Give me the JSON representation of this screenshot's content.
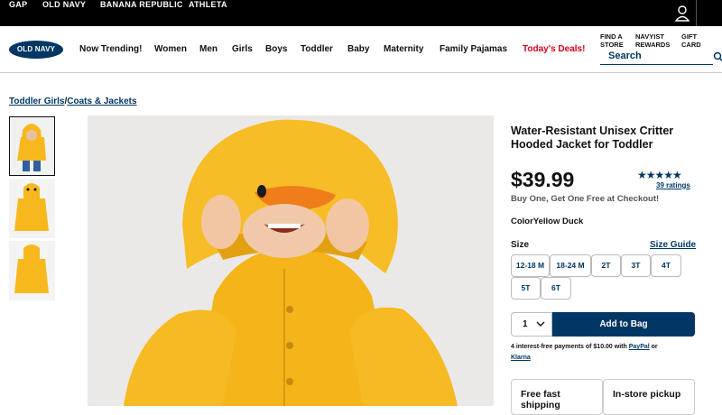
{
  "brandbar": {
    "brands": [
      "GAP",
      "OLD NAVY",
      "BANANA REPUBLIC",
      "ATHLETA"
    ]
  },
  "nav": {
    "logo": "OLD NAVY",
    "items": [
      "Now Trending!",
      "Women",
      "Men",
      "Girls",
      "Boys",
      "Toddler",
      "Baby",
      "Maternity",
      "Family Pajamas",
      "Today's Deals!"
    ],
    "utility": [
      {
        "line1": "FIND A",
        "line2": "STORE"
      },
      {
        "line1": "NAVYIST",
        "line2": "REWARDS"
      },
      {
        "line1": "GIFT",
        "line2": "CARD"
      }
    ],
    "search_label": "Search"
  },
  "breadcrumb": {
    "first": "Toddler Girls",
    "sep": "/",
    "second": "Coats & Jackets"
  },
  "product": {
    "title": "Water-Resistant Unisex Critter Hooded Jacket for Toddler",
    "price": "$39.99",
    "stars": "★★★★★",
    "ratings": "39 ratings",
    "promo": "Buy One, Get One Free at Checkout!",
    "color_label": "Color",
    "color_value": "Yellow Duck",
    "size_label": "Size",
    "size_guide": "Size Guide",
    "sizes": [
      "12-18 M",
      "18-24 M",
      "2T",
      "3T",
      "4T",
      "5T",
      "6T"
    ],
    "qty": "1",
    "add_to_bag": "Add to Bag",
    "pay_text": "4 interest-free payments of $10.00 with",
    "pay_paypal": "PayPal",
    "pay_or": "or",
    "pay_klarna": "Klarna",
    "ship_line1": "Free fast",
    "ship_line2": "shipping",
    "pickup": "In-store pickup"
  },
  "colors": {
    "navy": "#003764",
    "deals_red": "#d0021b",
    "duck_yellow": "#f6b81c"
  }
}
